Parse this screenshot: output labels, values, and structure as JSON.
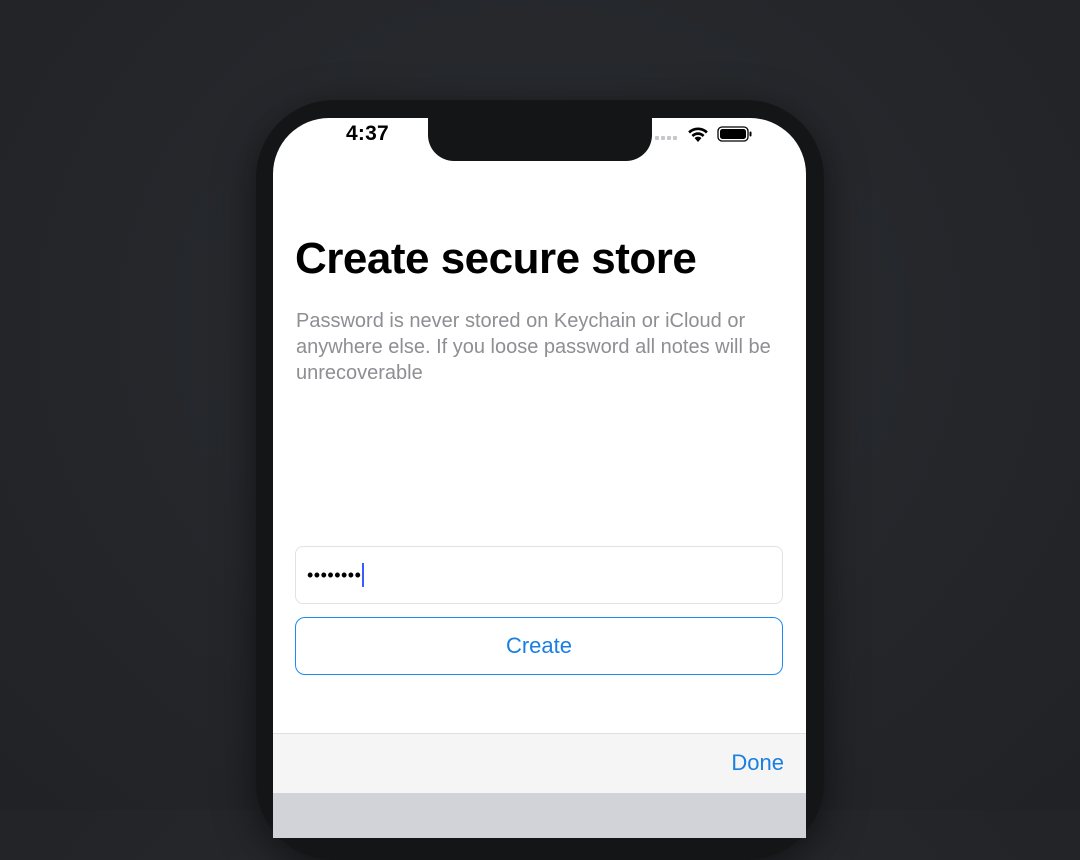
{
  "status_bar": {
    "time": "4:37"
  },
  "screen": {
    "title": "Create secure store",
    "description": "Password is never stored on Keychain or iCloud or anywhere else. If you loose password all notes will be unrecoverable",
    "password_field": {
      "value": "••••••••"
    },
    "create_label": "Create",
    "done_label": "Done"
  },
  "colors": {
    "accent": "#1a7fe0",
    "background": "#24262a",
    "caret": "#3d5afe"
  },
  "icons": [
    "signal-icon",
    "wifi-icon",
    "battery-icon"
  ]
}
